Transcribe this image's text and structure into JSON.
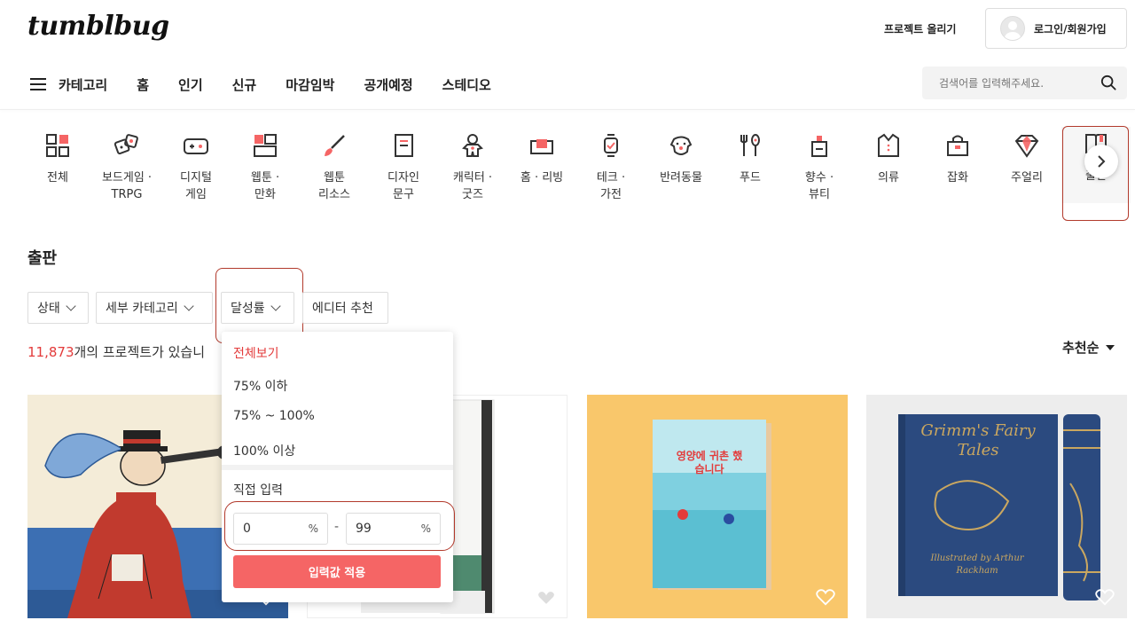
{
  "header": {
    "logo": "tumblbug",
    "upload_label": "프로젝트 올리기",
    "login_label": "로그인/회원가입"
  },
  "nav": {
    "category_label": "카테고리",
    "items": [
      "홈",
      "인기",
      "신규",
      "마감임박",
      "공개예정",
      "스테디오"
    ]
  },
  "search": {
    "placeholder": "검색어를 입력해주세요."
  },
  "categories": [
    {
      "line1": "전체",
      "line2": "",
      "icon": "grid-icon"
    },
    {
      "line1": "보드게임 ·",
      "line2": "TRPG",
      "icon": "dice-icon"
    },
    {
      "line1": "디지털",
      "line2": "게임",
      "icon": "gamepad-icon"
    },
    {
      "line1": "웹툰 ·",
      "line2": "만화",
      "icon": "comic-icon"
    },
    {
      "line1": "웹툰",
      "line2": "리소스",
      "icon": "brush-icon"
    },
    {
      "line1": "디자인",
      "line2": "문구",
      "icon": "notebook-icon"
    },
    {
      "line1": "캐릭터 ·",
      "line2": "굿즈",
      "icon": "gingerbread-icon"
    },
    {
      "line1": "홈 · 리빙",
      "line2": "",
      "icon": "sofa-icon"
    },
    {
      "line1": "테크 ·",
      "line2": "가전",
      "icon": "watch-icon"
    },
    {
      "line1": "반려동물",
      "line2": "",
      "icon": "dog-icon"
    },
    {
      "line1": "푸드",
      "line2": "",
      "icon": "utensils-icon"
    },
    {
      "line1": "향수 ·",
      "line2": "뷰티",
      "icon": "perfume-icon"
    },
    {
      "line1": "의류",
      "line2": "",
      "icon": "shirt-icon"
    },
    {
      "line1": "잡화",
      "line2": "",
      "icon": "bag-icon"
    },
    {
      "line1": "주얼리",
      "line2": "",
      "icon": "diamond-icon"
    },
    {
      "line1": "출판",
      "line2": "",
      "icon": "book-icon"
    }
  ],
  "section": {
    "title": "출판",
    "count_number": "11,873",
    "count_suffix": "개의 프로젝트가 있습니",
    "sort_label": "추천순"
  },
  "filters": {
    "status": "상태",
    "subcategory": "세부 카테고리",
    "achievement": "달성률",
    "editor": "에디터 추천"
  },
  "dropdown": {
    "options": [
      "전체보기",
      "75% 이하",
      "75% ~ 100%",
      "100% 이상"
    ],
    "selected": "전체보기",
    "custom_label": "직접 입력",
    "min_value": "0",
    "max_value": "99",
    "unit": "%",
    "dash": "-",
    "apply_label": "입력값 적용"
  },
  "cards": [
    {
      "title_on_cover": ""
    },
    {
      "title_on_cover": ""
    },
    {
      "title_on_cover": "영양에 귀촌 했습니다"
    },
    {
      "title_on_cover": "Grimm's Fairy Tales",
      "subtitle_on_cover": "Illustrated by Arthur Rackham"
    }
  ],
  "colors": {
    "accent": "#f56565",
    "highlight": "#b23a2c",
    "count": "#e33b3b"
  }
}
